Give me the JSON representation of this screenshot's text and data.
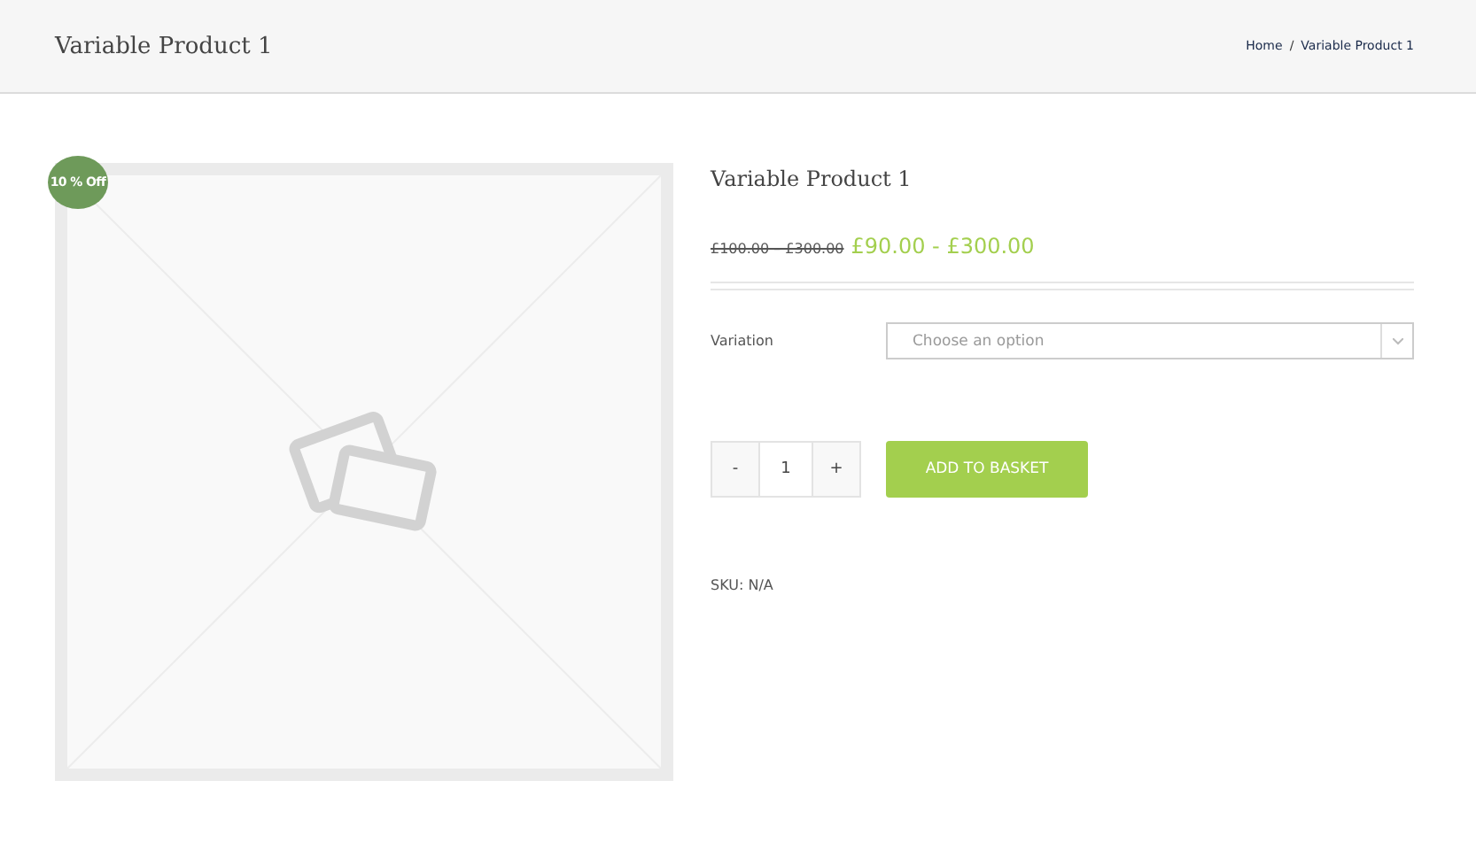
{
  "header": {
    "title": "Variable Product 1",
    "breadcrumbs": [
      "Home",
      "Variable Product 1"
    ],
    "separator": "/"
  },
  "product": {
    "badge": "10 % Off",
    "title": "Variable Product 1",
    "old_price": "£100.00 – £300.00",
    "price": "£90.00 - £300.00",
    "variation": {
      "label": "Variation",
      "placeholder": "Choose an option"
    },
    "quantity": {
      "minus": "-",
      "value": "1",
      "plus": "+"
    },
    "add_button": "ADD TO BASKET",
    "sku": "SKU: N/A"
  }
}
